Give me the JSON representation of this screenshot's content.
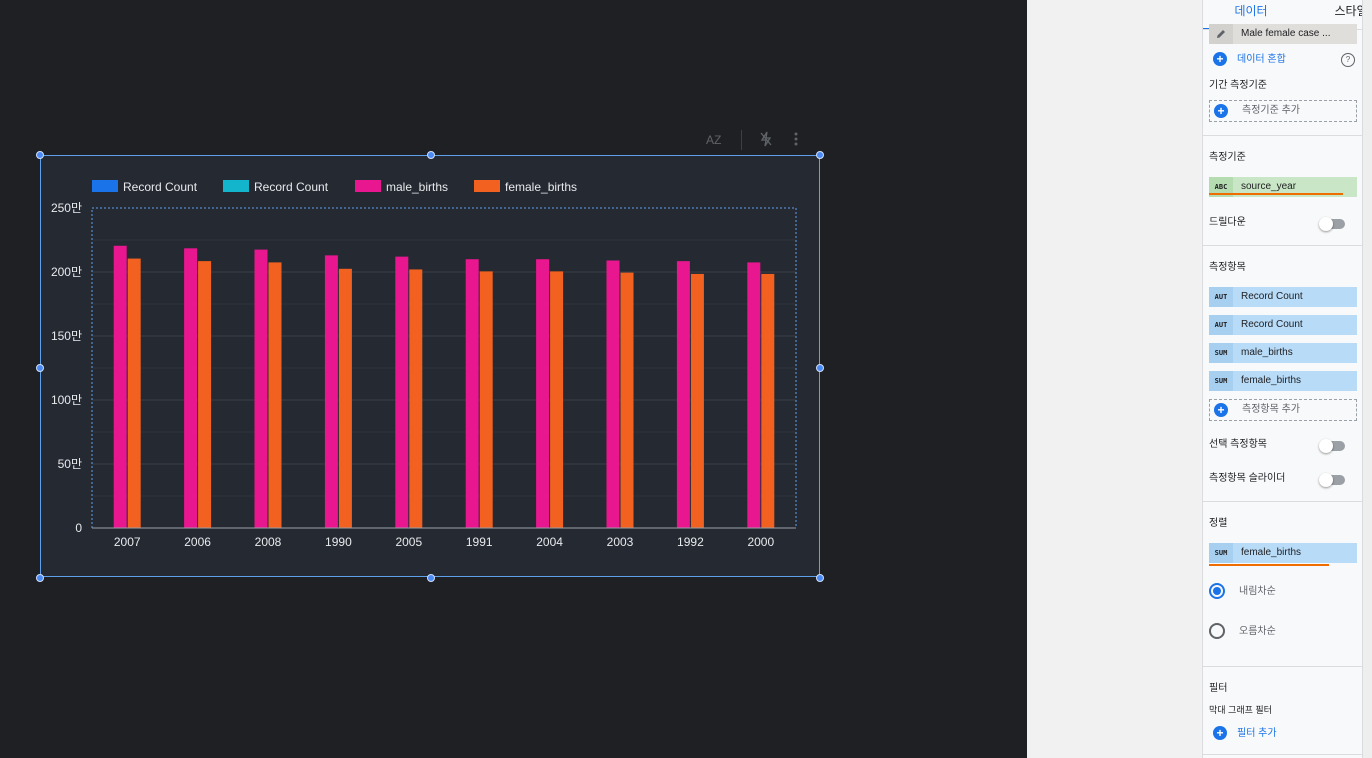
{
  "chart_toolbar": {
    "sort_icon": "sort-az-icon",
    "disable_interactions_icon": "lightning-off-icon",
    "more_icon": "more-vert-icon",
    "sort_text": "AZ"
  },
  "chart_data": {
    "type": "bar",
    "categories": [
      "2007",
      "2006",
      "2008",
      "1990",
      "2005",
      "1991",
      "2004",
      "2003",
      "1992",
      "2000"
    ],
    "series": [
      {
        "name": "Record Count",
        "color": "#1a73e8",
        "values": [
          null,
          null,
          null,
          null,
          null,
          null,
          null,
          null,
          null,
          null
        ]
      },
      {
        "name": "Record Count",
        "color": "#12b5cb",
        "values": [
          null,
          null,
          null,
          null,
          null,
          null,
          null,
          null,
          null,
          null
        ]
      },
      {
        "name": "male_births",
        "color": "#e8168f",
        "values": [
          2205000,
          2185000,
          2175000,
          2130000,
          2120000,
          2100000,
          2100000,
          2090000,
          2085000,
          2075000
        ]
      },
      {
        "name": "female_births",
        "color": "#f2611f",
        "values": [
          2105000,
          2085000,
          2075000,
          2025000,
          2020000,
          2005000,
          2005000,
          1995000,
          1985000,
          1985000
        ]
      }
    ],
    "yticks": [
      {
        "value": 0,
        "label": "0"
      },
      {
        "value": 500000,
        "label": "50만"
      },
      {
        "value": 1000000,
        "label": "100만"
      },
      {
        "value": 1500000,
        "label": "150만"
      },
      {
        "value": 2000000,
        "label": "200만"
      },
      {
        "value": 2500000,
        "label": "250만"
      }
    ],
    "ylim": [
      0,
      2500000
    ],
    "grid": true,
    "legend_position": "top-left"
  },
  "panel": {
    "tabs": {
      "data": "데이터",
      "style": "스타일"
    },
    "data_source": {
      "name": "Male female case ...",
      "icon": "pencil-icon"
    },
    "blend": {
      "label": "데이터 혼합",
      "help_icon": "help-icon"
    },
    "date_range_dimension": {
      "title": "기간 측정기준",
      "add": "측정기준 추가"
    },
    "dimension": {
      "title": "측정기준",
      "tag": "ABC",
      "field": "source_year"
    },
    "drilldown": {
      "label": "드릴다운"
    },
    "metrics": {
      "title": "측정항목",
      "items": [
        {
          "tag": "AUT",
          "field": "Record Count"
        },
        {
          "tag": "AUT",
          "field": "Record Count"
        },
        {
          "tag": "SUM",
          "field": "male_births"
        },
        {
          "tag": "SUM",
          "field": "female_births"
        }
      ],
      "add": "측정항목 추가"
    },
    "optional_metrics": {
      "label": "선택 측정항목"
    },
    "metric_slider": {
      "label": "측정항목 슬라이더"
    },
    "sort": {
      "title": "정렬",
      "tag": "SUM",
      "field": "female_births",
      "desc": "내림차순",
      "asc": "오름차순"
    },
    "filter": {
      "title": "필터",
      "subtitle": "막대 그래프 필터",
      "add": "필터 추가"
    }
  }
}
